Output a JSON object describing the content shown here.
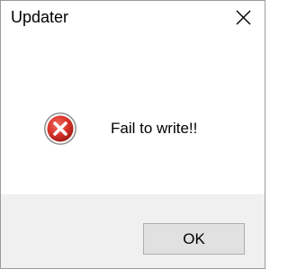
{
  "window": {
    "title": "Updater",
    "close_icon": "close-icon"
  },
  "content": {
    "icon": "error-icon",
    "message": "Fail to write!!"
  },
  "footer": {
    "ok_label": "OK"
  },
  "colors": {
    "error_red": "#d9342b",
    "footer_bg": "#f0f0f0",
    "button_bg": "#e1e1e1",
    "button_border": "#adadad"
  }
}
